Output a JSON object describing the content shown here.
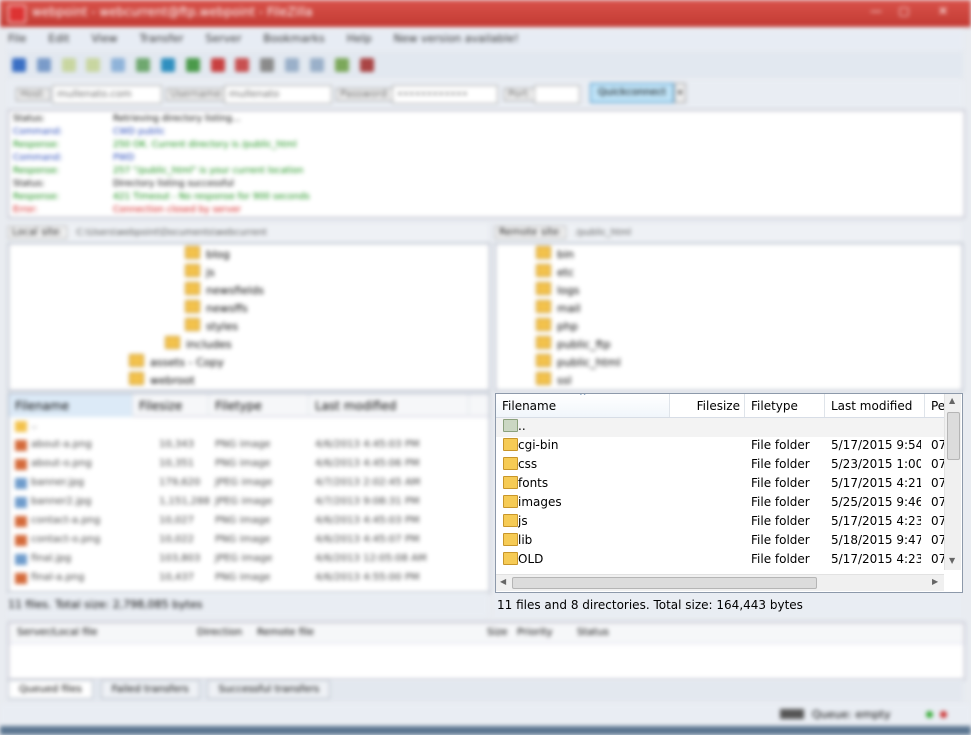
{
  "window": {
    "title": "webpoint - webcurrent@ftp.webpoint - FileZilla"
  },
  "menu": [
    "File",
    "Edit",
    "View",
    "Transfer",
    "Server",
    "Bookmarks",
    "Help",
    "New version available!"
  ],
  "quickconnect": {
    "host_label": "Host:",
    "host_value": "mullenato.com",
    "user_label": "Username:",
    "user_value": "mullenato",
    "pass_label": "Password:",
    "pass_value": "••••••••••••",
    "port_label": "Port:",
    "port_value": "",
    "button_label": "Quickconnect"
  },
  "log": [
    {
      "k": "Status:",
      "v": "Retrieving directory listing...",
      "c": "#000000"
    },
    {
      "k": "Command:",
      "v": "CWD public",
      "c": "#1a3fb5"
    },
    {
      "k": "Response:",
      "v": "250 OK. Current directory is /public_html",
      "c": "#0a8a0a"
    },
    {
      "k": "Command:",
      "v": "PWD",
      "c": "#1a3fb5"
    },
    {
      "k": "Response:",
      "v": "257 \"/public_html\" is your current location",
      "c": "#0a8a0a"
    },
    {
      "k": "Status:",
      "v": "Directory listing successful",
      "c": "#000000"
    },
    {
      "k": "Response:",
      "v": "421 Timeout - No response for 900 seconds",
      "c": "#0a8a0a"
    },
    {
      "k": "Error:",
      "v": "Connection closed by server",
      "c": "#d01010"
    }
  ],
  "local": {
    "site_label": "Local site:",
    "path": "C:\\Users\\webpoint\\Documents\\webcurrent",
    "tree": [
      "blog",
      "js",
      "newsfields",
      "newsffs",
      "styles",
      "includes",
      "assets - Copy",
      "webroot"
    ],
    "headers": [
      "Filename",
      "Filesize",
      "Filetype",
      "Last modified"
    ],
    "files": [
      {
        "name": "..",
        "size": "",
        "type": "",
        "mod": ""
      },
      {
        "name": "about-a.png",
        "size": "10,343",
        "type": "PNG image",
        "mod": "4/6/2013 4:45:03 PM"
      },
      {
        "name": "about-o.png",
        "size": "10,351",
        "type": "PNG image",
        "mod": "4/6/2013 4:45:06 PM"
      },
      {
        "name": "banner.jpg",
        "size": "179,620",
        "type": "JPEG image",
        "mod": "4/7/2013 2:02:45 AM"
      },
      {
        "name": "banner2.jpg",
        "size": "1,151,288",
        "type": "JPEG image",
        "mod": "4/7/2013 9:08:31 PM"
      },
      {
        "name": "contact-a.png",
        "size": "10,027",
        "type": "PNG image",
        "mod": "4/6/2013 4:45:03 PM"
      },
      {
        "name": "contact-o.png",
        "size": "10,022",
        "type": "PNG image",
        "mod": "4/6/2013 4:45:07 PM"
      },
      {
        "name": "final.jpg",
        "size": "103,803",
        "type": "JPEG image",
        "mod": "4/6/2013 12:05:08 AM"
      },
      {
        "name": "final-a.png",
        "size": "10,437",
        "type": "PNG image",
        "mod": "4/6/2013 4:55:00 PM"
      }
    ],
    "status": "11 files. Total size: 2,798,085 bytes"
  },
  "remote": {
    "site_label": "Remote site:",
    "path": "/public_html",
    "tree": [
      "bin",
      "etc",
      "logs",
      "mail",
      "php",
      "public_ftp",
      "public_html",
      "ssl"
    ],
    "headers": [
      "Filename",
      "Filesize",
      "Filetype",
      "Last modified",
      "Pe"
    ],
    "files": [
      {
        "name": "..",
        "size": "",
        "type": "",
        "mod": "",
        "perm": ""
      },
      {
        "name": "cgi-bin",
        "size": "",
        "type": "File folder",
        "mod": "5/17/2015 9:54:...",
        "perm": "07"
      },
      {
        "name": "css",
        "size": "",
        "type": "File folder",
        "mod": "5/23/2015 1:00:...",
        "perm": "07"
      },
      {
        "name": "fonts",
        "size": "",
        "type": "File folder",
        "mod": "5/17/2015 4:21:...",
        "perm": "07"
      },
      {
        "name": "images",
        "size": "",
        "type": "File folder",
        "mod": "5/25/2015 9:46:...",
        "perm": "07"
      },
      {
        "name": "js",
        "size": "",
        "type": "File folder",
        "mod": "5/17/2015 4:23:...",
        "perm": "07"
      },
      {
        "name": "lib",
        "size": "",
        "type": "File folder",
        "mod": "5/18/2015 9:47:...",
        "perm": "07"
      },
      {
        "name": "OLD",
        "size": "",
        "type": "File folder",
        "mod": "5/17/2015 4:23:...",
        "perm": "07"
      }
    ],
    "status": "11 files and 8 directories. Total size: 164,443 bytes"
  },
  "queue": {
    "headers": [
      "Server/Local file",
      "Direction",
      "Remote file",
      "Size",
      "Priority",
      "Status"
    ],
    "tabs": [
      "Queued files",
      "Failed transfers",
      "Successful transfers"
    ],
    "status": "Queue: empty"
  }
}
